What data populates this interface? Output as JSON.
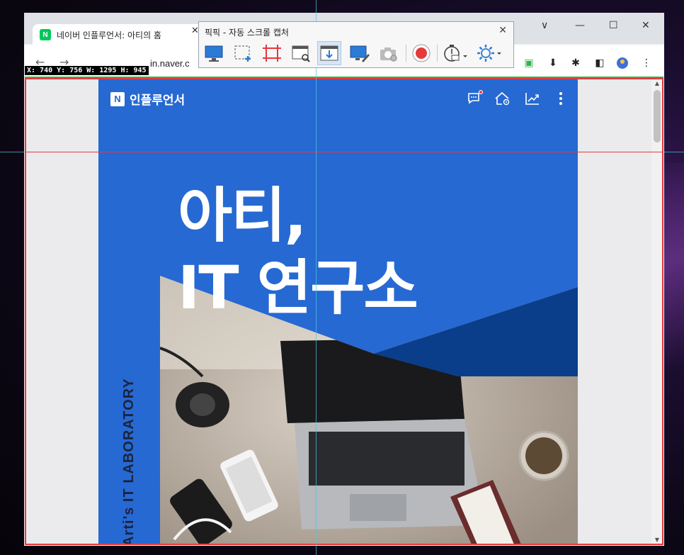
{
  "browser": {
    "tab_title": "네이버 인플루언서: 아티의 홈",
    "tab_favicon": "N",
    "address_text": "in.naver.c",
    "window_controls": [
      "∨",
      "—",
      "☐",
      "✕"
    ]
  },
  "capture_tool": {
    "title": "픽픽 - 자동 스크롤 캡처",
    "buttons": [
      {
        "name": "fullscreen-capture-icon"
      },
      {
        "name": "region-capture-icon"
      },
      {
        "name": "fixed-region-icon"
      },
      {
        "name": "window-capture-icon"
      },
      {
        "name": "scroll-capture-icon",
        "active": true
      },
      {
        "name": "screen-draw-icon"
      },
      {
        "name": "repeat-capture-icon"
      },
      {
        "name": "record-icon"
      },
      {
        "name": "timer-icon"
      },
      {
        "name": "settings-icon"
      }
    ]
  },
  "coords_label": "X: 740 Y: 756 W: 1295 H: 945",
  "page": {
    "brand_logo": "N",
    "brand_label": "인플루언서",
    "hero_line1": "아티,",
    "hero_line2": "IT 연구소",
    "vertical_text": "Arti's IT LABORATORY",
    "colors": {
      "primary": "#2669d2",
      "dark_triangle": "#0b3e8a",
      "capture_border": "#e5393c"
    }
  }
}
